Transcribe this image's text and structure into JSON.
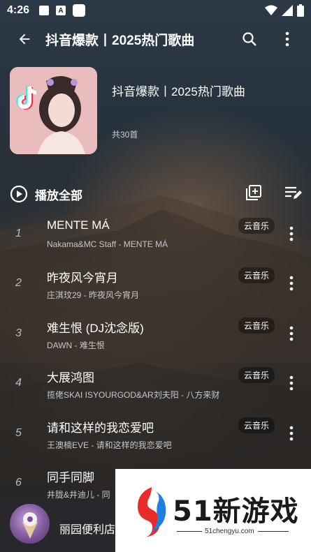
{
  "status_bar": {
    "time": "4:26"
  },
  "top_bar": {
    "title": "抖音爆款丨2025热门歌曲"
  },
  "playlist": {
    "name": "抖音爆款丨2025热门歌曲",
    "count": "共30首"
  },
  "play_all": {
    "label": "播放全部"
  },
  "songs": [
    {
      "index": "1",
      "title": "MENTE MÁ",
      "subtitle": "Nakama&MC Staff - MENTE MÁ",
      "source": "云音乐"
    },
    {
      "index": "2",
      "title": "昨夜风今宵月",
      "subtitle": "庄淇玟29 - 昨夜风今宵月",
      "source": "云音乐"
    },
    {
      "index": "3",
      "title": "难生恨 (DJ沈念版)",
      "subtitle": "DAWN - 难生恨",
      "source": "云音乐"
    },
    {
      "index": "4",
      "title": "大展鸿图",
      "subtitle": "揽佬SKAI ISYOURGOD&AR刘夫阳 - 八方来财",
      "source": "云音乐"
    },
    {
      "index": "5",
      "title": "请和这样的我恋爱吧",
      "subtitle": "王澳楠EVE - 请和这样的我恋爱吧",
      "source": "云音乐"
    },
    {
      "index": "6",
      "title": "同手同脚",
      "subtitle": "井胧&井迪儿 - 同",
      "source": ""
    }
  ],
  "mini_player": {
    "title": "丽园便利店"
  },
  "ad": {
    "brand": "51新游戏",
    "url": "51chengyu.com"
  }
}
